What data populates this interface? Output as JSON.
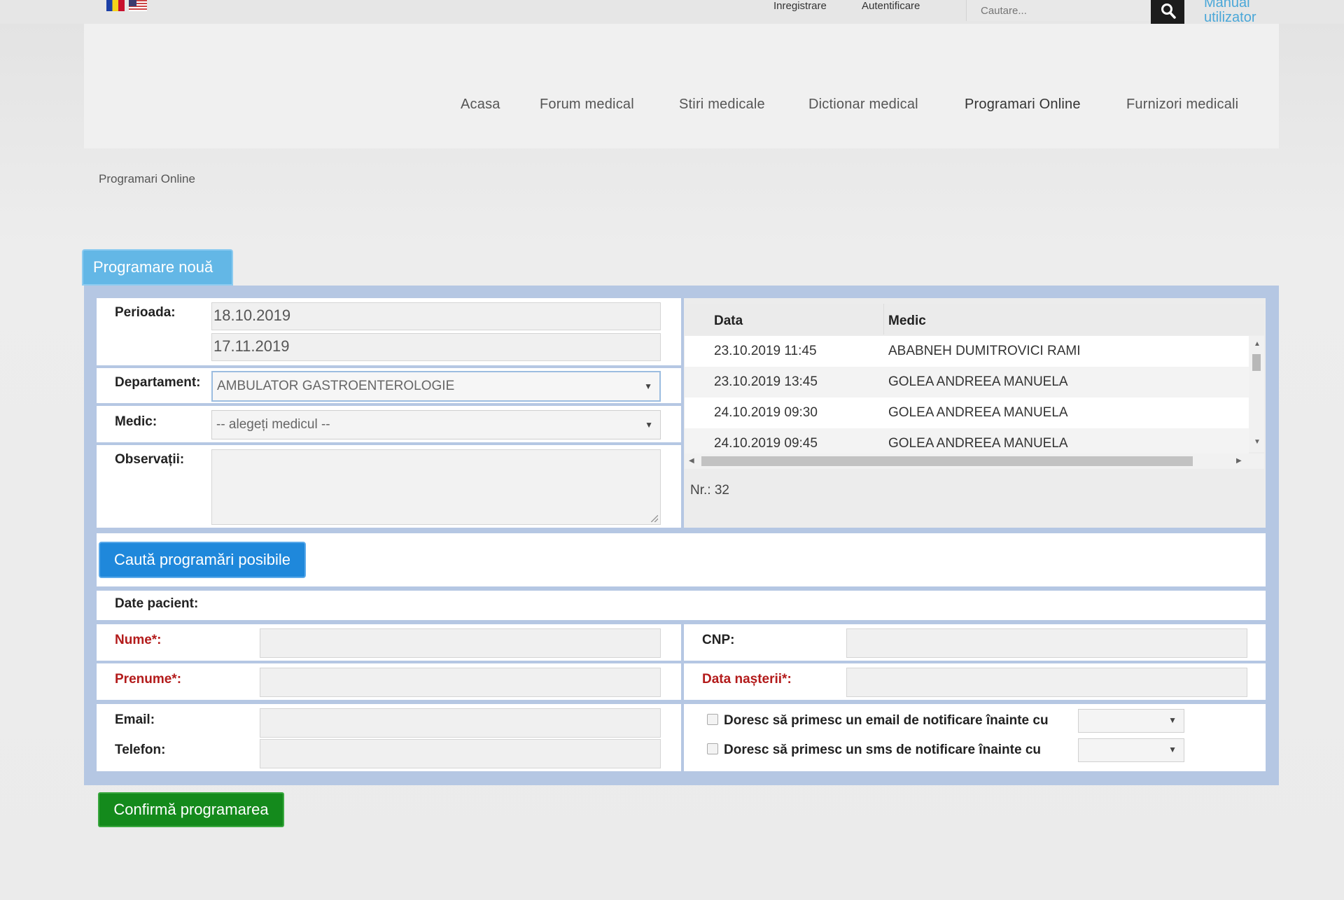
{
  "topbar": {
    "links": [
      "Inregistrare",
      "Autentificare"
    ],
    "search_placeholder": "Cautare...",
    "manual_label": "Manual utilizator"
  },
  "nav": {
    "items": [
      "Acasa",
      "Forum medical",
      "Stiri medicale",
      "Dictionar medical",
      "Programari Online",
      "Furnizori medicali"
    ],
    "active": "Programari Online"
  },
  "breadcrumb": "Programari Online",
  "tab_label": "Programare nouă",
  "form": {
    "perioada_label": "Perioada:",
    "perioada_start": "18.10.2019",
    "perioada_end": "17.11.2019",
    "departament_label": "Departament:",
    "departament_value": "AMBULATOR GASTROENTEROLOGIE",
    "medic_label": "Medic:",
    "medic_value": "-- alegeți medicul --",
    "observatii_label": "Observații:"
  },
  "results": {
    "columns": [
      "Data",
      "Medic"
    ],
    "rows": [
      {
        "data": "23.10.2019 11:45",
        "medic": "ABABNEH DUMITROVICI RAMI"
      },
      {
        "data": "23.10.2019 13:45",
        "medic": "GOLEA ANDREEA MANUELA"
      },
      {
        "data": "24.10.2019 09:30",
        "medic": "GOLEA ANDREEA MANUELA"
      },
      {
        "data": "24.10.2019 09:45",
        "medic": "GOLEA ANDREEA MANUELA"
      }
    ],
    "count_label": "Nr.: 32"
  },
  "search_button": "Caută programări posibile",
  "patient": {
    "section_label": "Date pacient:",
    "nume_label": "Nume*:",
    "prenume_label": "Prenume*:",
    "cnp_label": "CNP:",
    "data_nasterii_label": "Data nașterii*:",
    "email_label": "Email:",
    "telefon_label": "Telefon:",
    "email_notify_label": "Doresc să primesc un email de notificare înainte cu",
    "sms_notify_label": "Doresc să primesc un sms de notificare înainte cu"
  },
  "confirm_button": "Confirmă programarea",
  "colors": {
    "accent_blue": "#1f88db",
    "tab_blue": "#63b7e6",
    "confirm_green": "#148a1c",
    "frame_blue": "#b5c7e3",
    "required_red": "#b31b1b"
  }
}
